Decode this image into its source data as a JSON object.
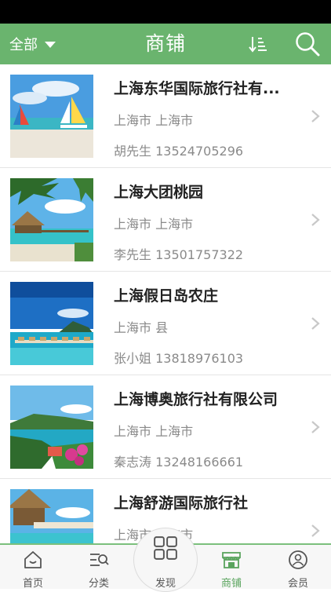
{
  "header": {
    "filter_label": "全部",
    "title": "商铺",
    "bg_color": "#6ab46e"
  },
  "shops": [
    {
      "name": "上海东华国际旅行社有...",
      "location": "上海市 上海市",
      "contact": "胡先生 13524705296"
    },
    {
      "name": "上海大团桃园",
      "location": "上海市 上海市",
      "contact": "李先生 13501757322"
    },
    {
      "name": "上海假日岛农庄",
      "location": "上海市 县",
      "contact": "张小姐 13818976103"
    },
    {
      "name": "上海博奥旅行社有限公司",
      "location": "上海市 上海市",
      "contact": "秦志涛 13248166661"
    },
    {
      "name": "上海舒游国际旅行社",
      "location": "上海市 上海市",
      "contact": ""
    }
  ],
  "tabs": [
    {
      "label": "首页",
      "icon": "home-icon"
    },
    {
      "label": "分类",
      "icon": "category-icon"
    },
    {
      "label": "发现",
      "icon": "discover-icon"
    },
    {
      "label": "商铺",
      "icon": "shop-icon",
      "active": true
    },
    {
      "label": "会员",
      "icon": "member-icon"
    }
  ]
}
